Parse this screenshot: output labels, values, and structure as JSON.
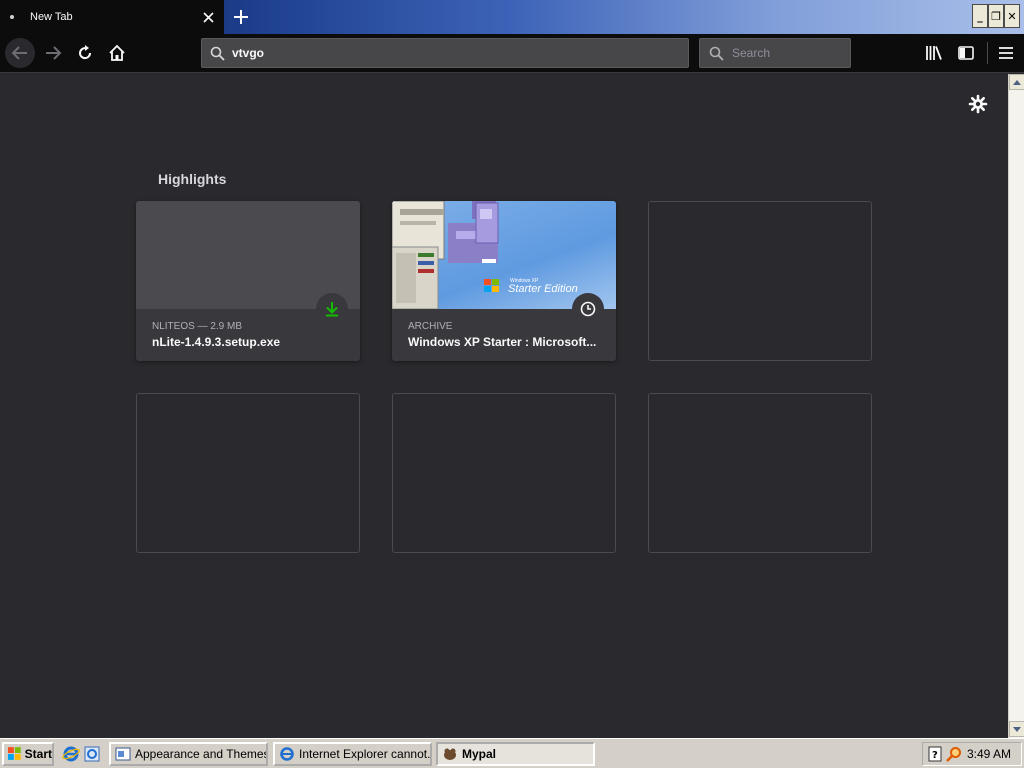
{
  "tab": {
    "title": "New Tab"
  },
  "window_controls": {
    "minimize": "_",
    "restore": "❐",
    "close": "✕"
  },
  "navbar": {
    "url_value": "vtvgo",
    "search_placeholder": "Search"
  },
  "highlights": {
    "title": "Highlights",
    "cards": [
      {
        "context": "NLITEOS — 2.9 MB",
        "title": "nLite-1.4.9.3.setup.exe",
        "badge": "download-icon"
      },
      {
        "context": "ARCHIVE",
        "title": "Windows XP Starter : Microsoft...",
        "badge": "history-icon",
        "thumb_text": "Starter Edition"
      }
    ]
  },
  "taskbar": {
    "start_label": "Start",
    "buttons": [
      {
        "label": "Appearance and Themes"
      },
      {
        "label": "Internet Explorer cannot..."
      },
      {
        "label": "Mypal"
      }
    ],
    "clock": "3:49 AM"
  },
  "colors": {
    "download_green": "#12bc00",
    "tab_bg": "#0c0c0d",
    "page_bg": "#2a2a2e"
  }
}
